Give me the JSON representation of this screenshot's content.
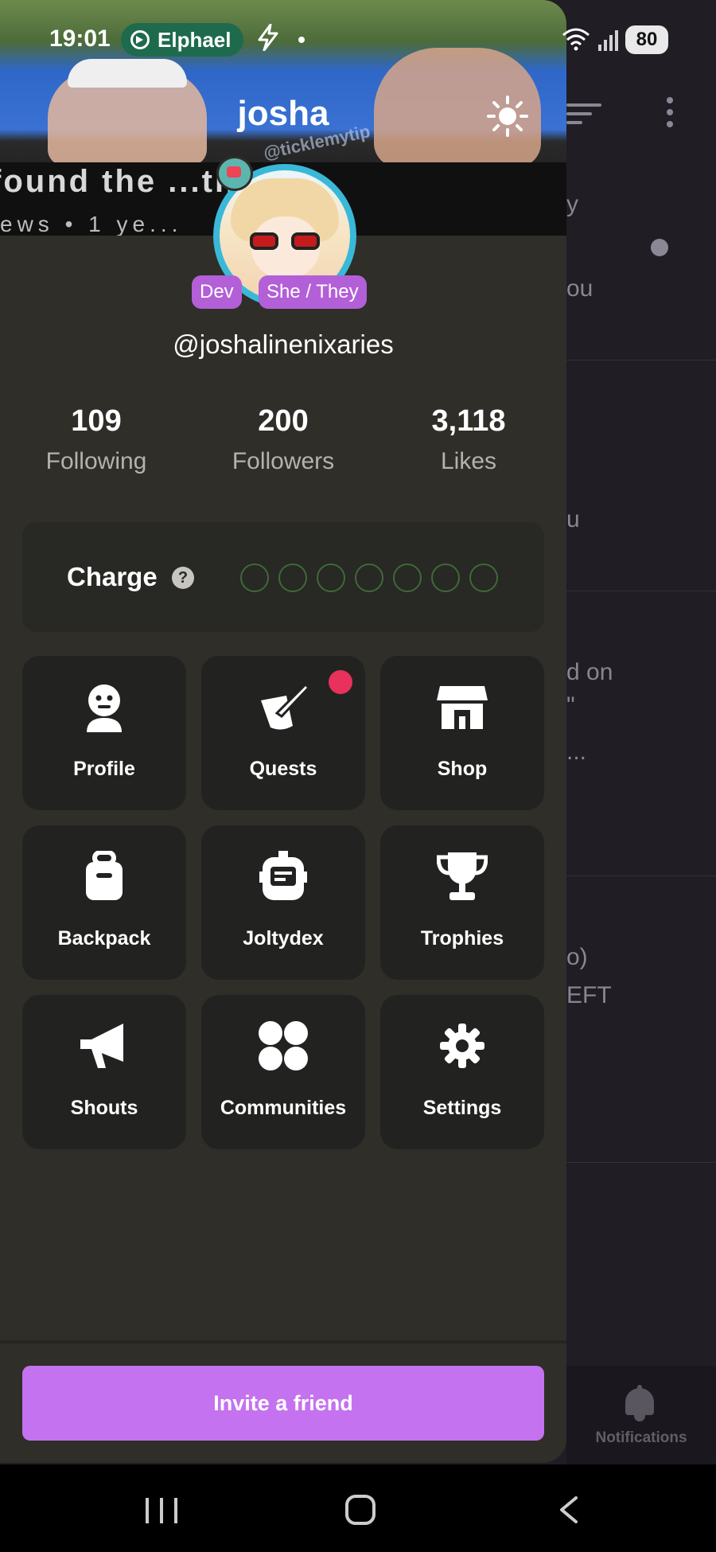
{
  "status_bar": {
    "time": "19:01",
    "app_pill": "Elphael",
    "battery": "80"
  },
  "background_app": {
    "snippets": [
      "y",
      "ou",
      "u",
      "d on",
      "\"",
      "...",
      "o)",
      "EFT"
    ],
    "notifications_label": "Notifications"
  },
  "drawer": {
    "title": "josha",
    "banner": {
      "video_title_fragment": "found the ...th!",
      "video_meta_fragment": "ews • 1 ye...",
      "watermark": "@ticklemytip"
    },
    "tags": [
      "Dev",
      "She / They"
    ],
    "handle": "@joshalinenixaries",
    "stats": [
      {
        "value": "109",
        "label": "Following"
      },
      {
        "value": "200",
        "label": "Followers"
      },
      {
        "value": "3,118",
        "label": "Likes"
      }
    ],
    "charge": {
      "label": "Charge",
      "help_icon": "?",
      "filled": 0,
      "total": 7
    },
    "menu": [
      {
        "label": "Profile",
        "icon": "face-icon"
      },
      {
        "label": "Quests",
        "icon": "quill-scroll-icon",
        "notification_dot": true
      },
      {
        "label": "Shop",
        "icon": "storefront-icon"
      },
      {
        "label": "Backpack",
        "icon": "backpack-icon"
      },
      {
        "label": "Joltydex",
        "icon": "dex-device-icon"
      },
      {
        "label": "Trophies",
        "icon": "trophy-icon"
      },
      {
        "label": "Shouts",
        "icon": "megaphone-icon"
      },
      {
        "label": "Communities",
        "icon": "four-dots-icon"
      },
      {
        "label": "Settings",
        "icon": "gear-icon"
      }
    ],
    "invite_button": "Invite a friend"
  },
  "colors": {
    "drawer_bg": "#2f2e28",
    "accent": "#c472f0",
    "tag": "#b35fd8",
    "notification_dot": "#e8315b",
    "charge_dot_outline": "#3e6a38"
  }
}
